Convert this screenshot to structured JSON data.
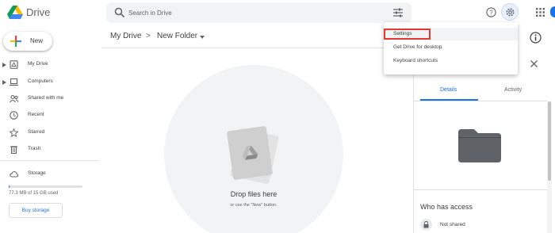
{
  "app": {
    "name": "Drive"
  },
  "search": {
    "placeholder": "Search in Drive"
  },
  "new_button": {
    "label": "New"
  },
  "sidebar": {
    "items": [
      {
        "label": "My Drive",
        "icon": "my-drive-icon",
        "expandable": true
      },
      {
        "label": "Computers",
        "icon": "computers-icon",
        "expandable": true
      },
      {
        "label": "Shared with me",
        "icon": "shared-with-me-icon",
        "expandable": false
      },
      {
        "label": "Recent",
        "icon": "clock-icon",
        "expandable": false
      },
      {
        "label": "Starred",
        "icon": "star-icon",
        "expandable": false
      },
      {
        "label": "Trash",
        "icon": "trash-icon",
        "expandable": false
      }
    ],
    "storage": {
      "label": "Storage",
      "usage_text": "77.3 MB of 15 GB used",
      "used_fraction": 0.005,
      "buy_label": "Buy storage"
    }
  },
  "breadcrumb": {
    "root": "My Drive",
    "separator": ">",
    "current": "New Folder"
  },
  "drop_zone": {
    "title": "Drop files here",
    "subtitle": "or use the \"New\" button."
  },
  "settings_menu": {
    "items": [
      "Settings",
      "Get Drive for desktop",
      "Keyboard shortcuts"
    ],
    "highlighted_index": 0
  },
  "details_panel": {
    "tabs": [
      "Details",
      "Activity"
    ],
    "active_tab": "Details",
    "access_title": "Who has access",
    "access_status": "Not shared"
  },
  "colors": {
    "accent": "#1a73e8",
    "highlight_border": "#e53935",
    "folder": "#5f6368"
  }
}
